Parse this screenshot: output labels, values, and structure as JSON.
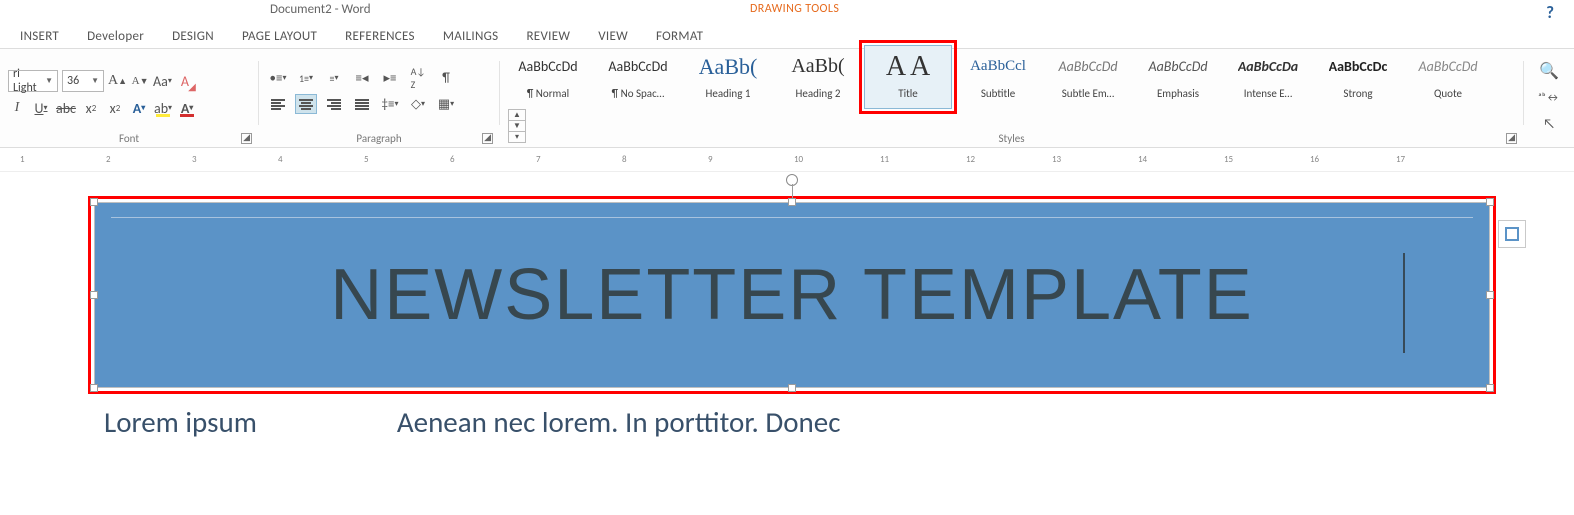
{
  "window": {
    "title": "Document2 - Word",
    "context_tab": "DRAWING TOOLS"
  },
  "tabs": {
    "insert": "INSERT",
    "developer": "Developer",
    "design": "DESIGN",
    "page_layout": "PAGE LAYOUT",
    "references": "REFERENCES",
    "mailings": "MAILINGS",
    "review": "REVIEW",
    "view": "VIEW",
    "format": "FORMAT"
  },
  "font": {
    "name_value": "ri Light",
    "size_value": "36",
    "group_label": "Font"
  },
  "paragraph": {
    "group_label": "Paragraph"
  },
  "styles": {
    "group_label": "Styles",
    "items": [
      {
        "preview": "AaBbCcDd",
        "label": "¶ Normal",
        "color": "#333",
        "size": "14px",
        "weight": "400",
        "style": "normal",
        "family": "Calibri"
      },
      {
        "preview": "AaBbCcDd",
        "label": "¶ No Spac…",
        "color": "#333",
        "size": "14px",
        "weight": "400",
        "style": "normal",
        "family": "Calibri"
      },
      {
        "preview": "AaBb(",
        "label": "Heading 1",
        "color": "#2a6099",
        "size": "22px",
        "weight": "300",
        "style": "normal",
        "family": "Calibri Light"
      },
      {
        "preview": "AaBb(",
        "label": "Heading 2",
        "color": "#333",
        "size": "20px",
        "weight": "300",
        "style": "normal",
        "family": "Calibri Light"
      },
      {
        "preview": "A A",
        "label": "Title",
        "color": "#333",
        "size": "28px",
        "weight": "300",
        "style": "normal",
        "family": "Calibri Light"
      },
      {
        "preview": "AaBbCcl",
        "label": "Subtitle",
        "color": "#2a6099",
        "size": "15px",
        "weight": "300",
        "style": "normal",
        "family": "Calibri Light"
      },
      {
        "preview": "AaBbCcDd",
        "label": "Subtle Em…",
        "color": "#777",
        "size": "14px",
        "weight": "400",
        "style": "italic",
        "family": "Calibri"
      },
      {
        "preview": "AaBbCcDd",
        "label": "Emphasis",
        "color": "#555",
        "size": "14px",
        "weight": "400",
        "style": "italic",
        "family": "Calibri"
      },
      {
        "preview": "AaBbCcDa",
        "label": "Intense E…",
        "color": "#333",
        "size": "14px",
        "weight": "700",
        "style": "italic",
        "family": "Calibri"
      },
      {
        "preview": "AaBbCcDc",
        "label": "Strong",
        "color": "#222",
        "size": "14px",
        "weight": "700",
        "style": "normal",
        "family": "Calibri"
      },
      {
        "preview": "AaBbCcDd",
        "label": "Quote",
        "color": "#888",
        "size": "14px",
        "weight": "400",
        "style": "italic",
        "family": "Calibri"
      }
    ],
    "selected_index": 4
  },
  "ruler_numbers": [
    "1",
    "2",
    "3",
    "4",
    "5",
    "6",
    "7",
    "8",
    "9",
    "10",
    "11",
    "12",
    "13",
    "14",
    "15",
    "16",
    "17"
  ],
  "document": {
    "title_text": "NEWSLETTER TEMPLATE",
    "body_left": "Lorem ipsum",
    "body_right": "Aenean nec lorem. In porttitor. Donec"
  }
}
